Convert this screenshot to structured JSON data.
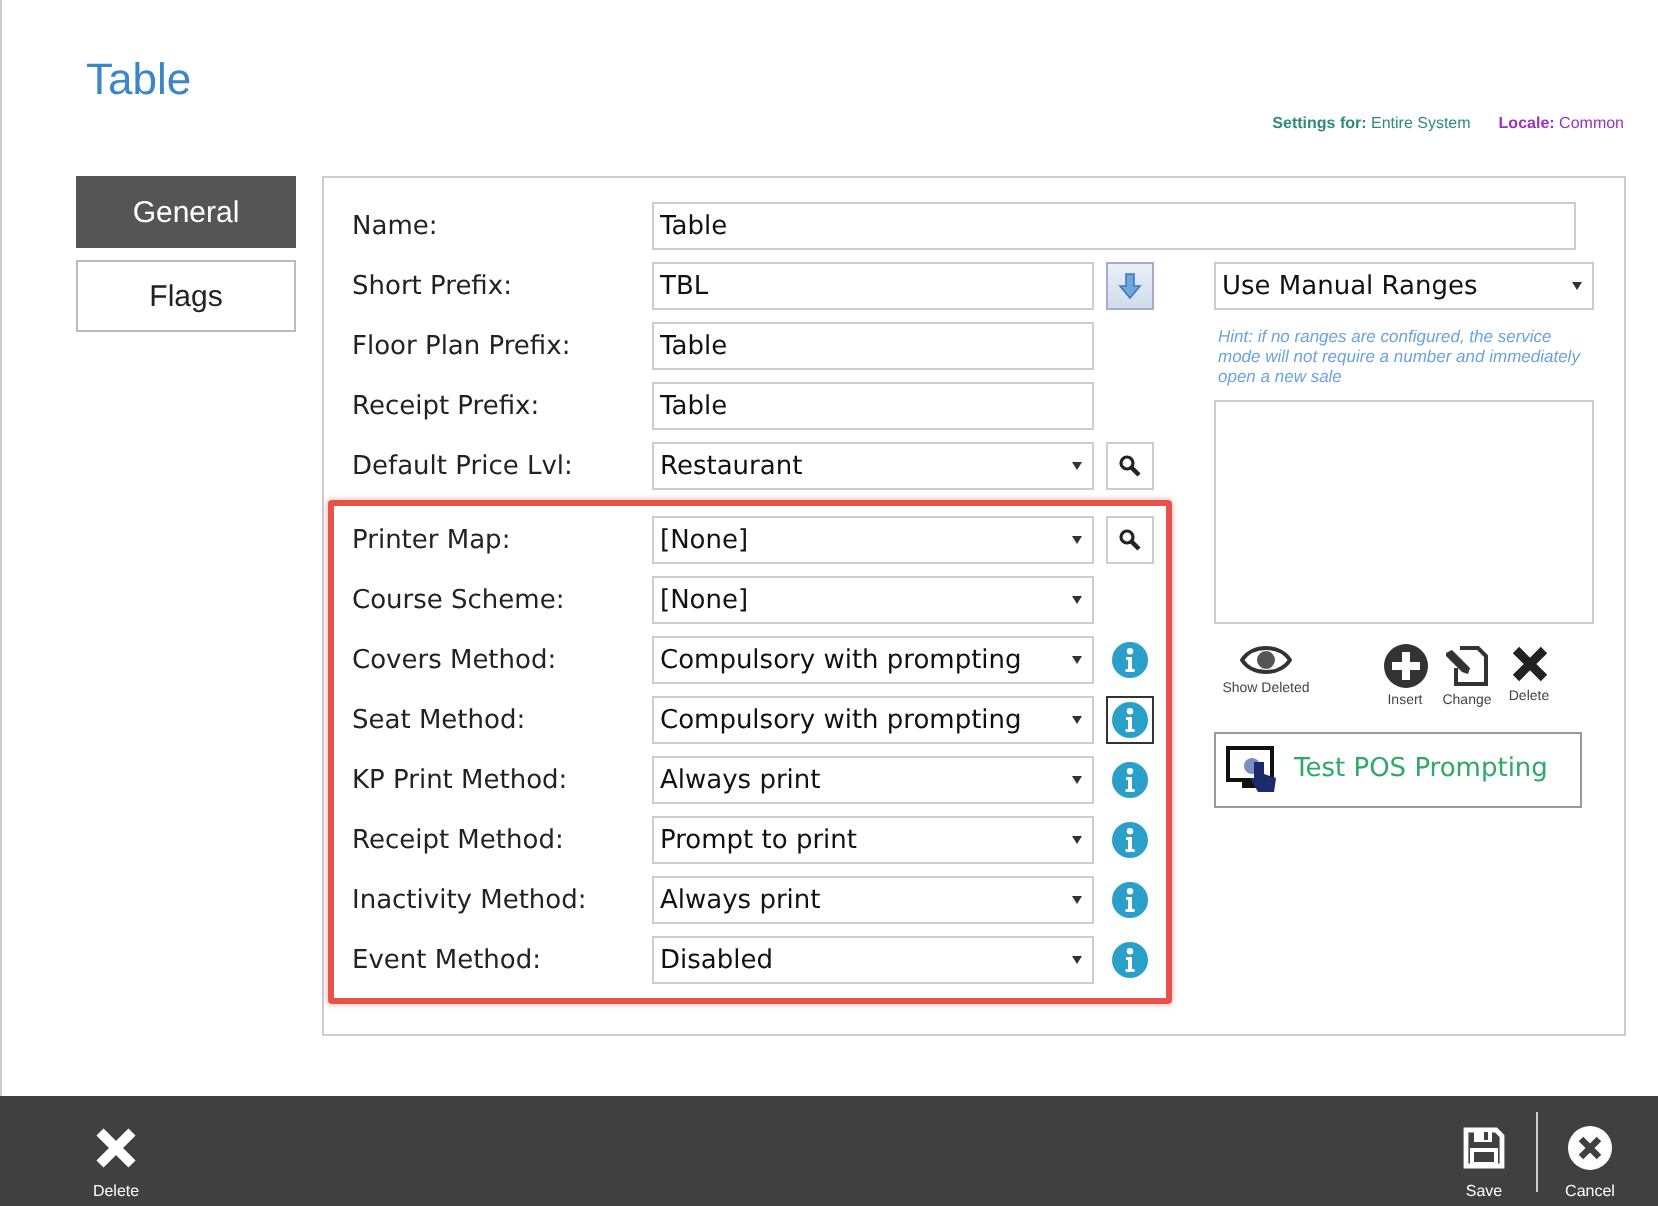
{
  "page": {
    "title": "Table"
  },
  "context": {
    "settings_label": "Settings for:",
    "settings_value": "Entire System",
    "locale_label": "Locale:",
    "locale_value": "Common"
  },
  "tabs": [
    {
      "label": "General",
      "selected": true
    },
    {
      "label": "Flags",
      "selected": false
    }
  ],
  "name_field": {
    "label": "Name:",
    "value": "Table"
  },
  "sections": [
    {
      "highlighted": false,
      "rows": [
        {
          "label": "Short Prefix:",
          "kind": "text",
          "value": "TBL",
          "extra": {
            "kind": "arrow",
            "focused": false
          }
        },
        {
          "label": "Floor Plan Prefix:",
          "kind": "text",
          "value": "Table"
        },
        {
          "label": "Receipt Prefix:",
          "kind": "text",
          "value": "Table"
        },
        {
          "label": "Default Price Lvl:",
          "kind": "select",
          "value": "Restaurant",
          "extra": {
            "kind": "search",
            "focused": false
          }
        }
      ]
    },
    {
      "highlighted": true,
      "rows": [
        {
          "label": "Printer Map:",
          "kind": "select",
          "value": "[None]",
          "extra": {
            "kind": "search",
            "focused": false
          }
        },
        {
          "label": "Course Scheme:",
          "kind": "select",
          "value": "[None]"
        },
        {
          "label": "Covers Method:",
          "kind": "select",
          "value": "Compulsory with prompting",
          "extra": {
            "kind": "info",
            "focused": false
          }
        },
        {
          "label": "Seat Method:",
          "kind": "select",
          "value": "Compulsory with prompting",
          "extra": {
            "kind": "info",
            "focused": true
          }
        },
        {
          "label": "KP Print Method:",
          "kind": "select",
          "value": "Always print",
          "extra": {
            "kind": "info",
            "focused": false
          }
        },
        {
          "label": "Receipt Method:",
          "kind": "select",
          "value": "Prompt to print",
          "extra": {
            "kind": "info",
            "focused": false
          }
        },
        {
          "label": "Inactivity Method:",
          "kind": "select",
          "value": "Always print",
          "extra": {
            "kind": "info",
            "focused": false
          }
        },
        {
          "label": "Event Method:",
          "kind": "select",
          "value": "Disabled",
          "extra": {
            "kind": "info",
            "focused": false
          }
        }
      ]
    }
  ],
  "ranges": {
    "mode": "Use Manual Ranges",
    "hint": "Hint: if no ranges are configured, the service mode will not require a number and immediately open a new sale",
    "actions": [
      {
        "kind": "eye",
        "label": "Show Deleted"
      },
      {
        "kind": "plus",
        "label": "Insert"
      },
      {
        "kind": "edit",
        "label": "Change"
      },
      {
        "kind": "x",
        "label": "Delete"
      }
    ],
    "test_button": "Test POS Prompting"
  },
  "footer": {
    "left": [
      {
        "kind": "x",
        "label": "Delete"
      }
    ],
    "right": [
      {
        "kind": "save",
        "label": "Save"
      },
      {
        "kind": "cancel",
        "label": "Cancel"
      }
    ]
  }
}
